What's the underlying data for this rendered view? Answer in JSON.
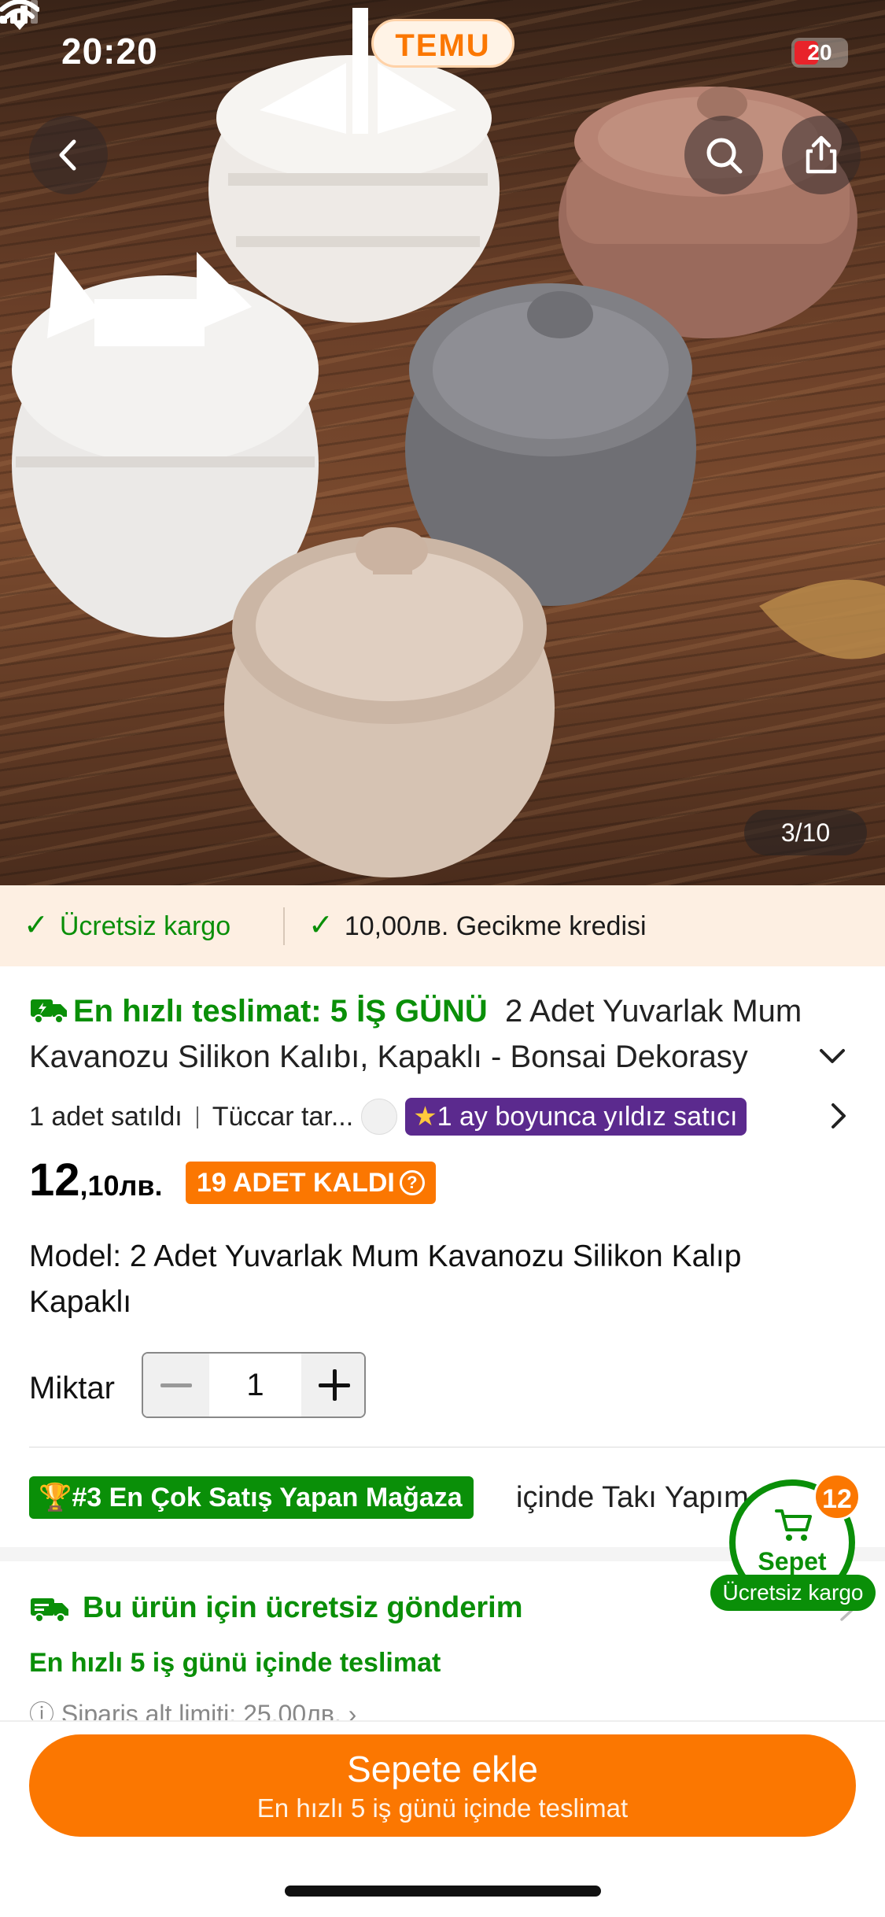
{
  "status_bar": {
    "time": "20:20",
    "battery": "20",
    "app_logo": "TEMU"
  },
  "gallery": {
    "counter": "3/10",
    "icons": [
      "back-arrow-icon",
      "search-icon",
      "share-icon"
    ]
  },
  "benefits": {
    "free_shipping": "Ücretsiz kargo",
    "delay_credit": "10,00лв. Gecikme kredisi"
  },
  "product": {
    "fast_delivery": "En hızlı teslimat: 5 İŞ GÜNÜ",
    "title": "2 Adet Yuvarlak Mum Kavanozu Silikon Kalıbı, Kapaklı - Bonsai Dekorasy",
    "sold": "1 adet satıldı",
    "seller": "Tüccar tar...",
    "star_seller": "1 ay boyunca yıldız satıcı",
    "price_major": "12",
    "price_minor": ",10лв.",
    "stock": "19 ADET KALDI",
    "model": "Model: 2 Adet Yuvarlak Mum Kavanozu Silikon Kalıp Kapaklı",
    "quantity_label": "Miktar",
    "quantity": "1"
  },
  "ranking": {
    "badge": "#3 En Çok Satış Yapan Mağaza",
    "text": "içinde Takı Yapım"
  },
  "shipping": {
    "title": "Bu ürün için ücretsiz gönderim",
    "fastest": "En hızlı 5 iş günü içinde teslimat",
    "min_order": "Sipariş alt limiti: 25,00лв."
  },
  "cart": {
    "label": "Sepet",
    "count": "12",
    "free_shipping": "Ücretsiz kargo"
  },
  "cta": {
    "label": "Sepete ekle",
    "sub": "En hızlı 5 iş günü içinde teslimat"
  },
  "colors": {
    "accent_orange": "#fb7701",
    "green": "#0a8f08",
    "star_purple": "#5b2a8e",
    "benefit_bg": "#fdefe2"
  }
}
